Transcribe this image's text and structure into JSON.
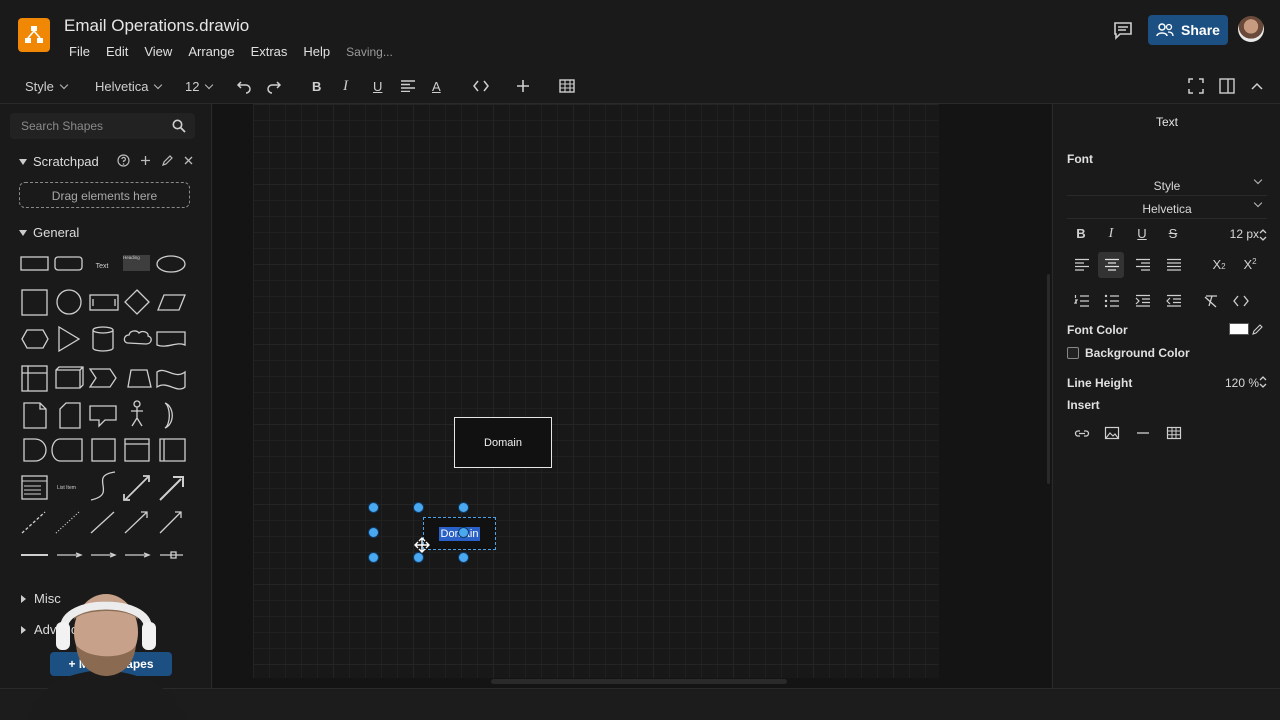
{
  "app": {
    "title": "Email Operations.drawio",
    "menu": [
      "File",
      "Edit",
      "View",
      "Arrange",
      "Extras",
      "Help"
    ],
    "save_status": "Saving...",
    "share_label": "Share",
    "brand_color": "#f08705",
    "accent_color": "#1c4f82"
  },
  "toolbar": {
    "style_label": "Style",
    "font_label": "Helvetica",
    "size_label": "12",
    "icons": [
      "undo-icon",
      "redo-icon",
      "bold-icon",
      "italic-icon",
      "underline-icon",
      "align-icon",
      "font-color-icon",
      "code-icon",
      "insert-icon",
      "table-icon",
      "fullscreen-icon",
      "format-panel-icon",
      "collapse-icon"
    ]
  },
  "sidebar": {
    "search_placeholder": "Search Shapes",
    "scratchpad_label": "Scratchpad",
    "drag_hint": "Drag elements here",
    "general_label": "General",
    "misc_label": "Misc",
    "advanced_label": "Advanced",
    "more_shapes_label": "+ More Shapes",
    "shape_text_label": "Text",
    "shape_heading_label": "Heading",
    "shape_list_label": "List Item"
  },
  "canvas": {
    "shape1_label": "Domain",
    "shape2_label": "Domain",
    "selection_color": "#4aa8f0"
  },
  "format_panel": {
    "tab_label": "Text",
    "font_section": "Font",
    "style_value": "Style",
    "font_value": "Helvetica",
    "size_value": "12 px",
    "font_color_label": "Font Color",
    "font_color_value": "#ffffff",
    "background_color_label": "Background Color",
    "background_color_checked": false,
    "line_height_label": "Line Height",
    "line_height_value": "120 %",
    "insert_label": "Insert"
  }
}
